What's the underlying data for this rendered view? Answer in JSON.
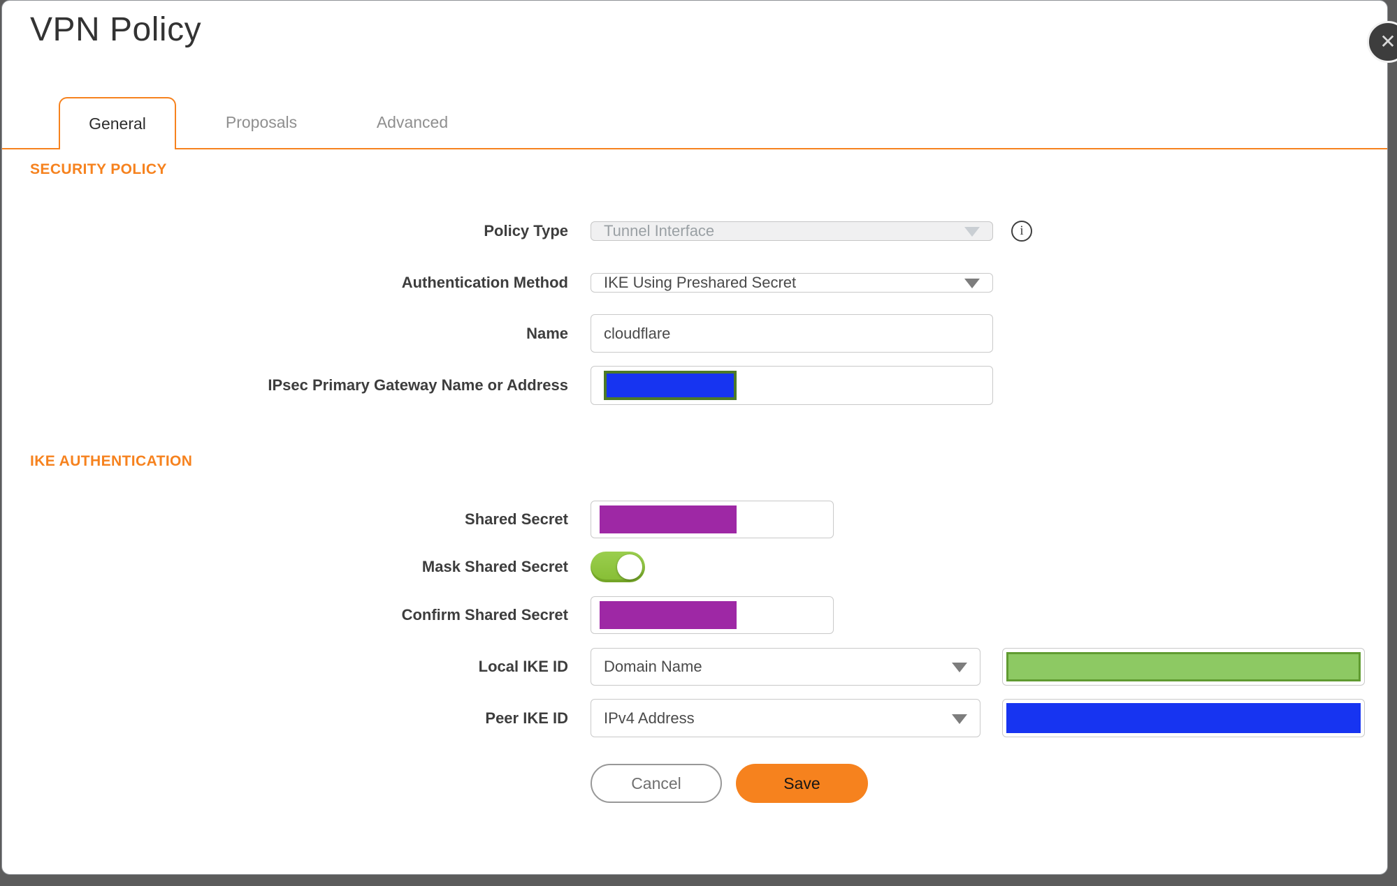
{
  "window": {
    "title": "VPN Policy",
    "close_glyph": "✕"
  },
  "tabs": {
    "general": "General",
    "proposals": "Proposals",
    "advanced": "Advanced",
    "active_tab": "General"
  },
  "security_policy": {
    "heading": "SECURITY POLICY",
    "policy_type_label": "Policy Type",
    "policy_type_value": "Tunnel Interface",
    "policy_type_disabled": true,
    "info_glyph": "i",
    "auth_method_label": "Authentication Method",
    "auth_method_value": "IKE Using Preshared Secret",
    "name_label": "Name",
    "name_value": "cloudflare",
    "gateway_label": "IPsec Primary Gateway Name or Address",
    "gateway_value_redacted": true
  },
  "ike_authentication": {
    "heading": "IKE AUTHENTICATION",
    "shared_secret_label": "Shared Secret",
    "shared_secret_redacted": true,
    "mask_shared_secret_label": "Mask Shared Secret",
    "mask_shared_secret_state": "on",
    "confirm_shared_secret_label": "Confirm Shared Secret",
    "confirm_shared_secret_redacted": true,
    "local_ike_id_label": "Local IKE ID",
    "local_ike_id_type": "Domain Name",
    "local_ike_id_value_redacted": true,
    "peer_ike_id_label": "Peer IKE ID",
    "peer_ike_id_type": "IPv4 Address",
    "peer_ike_id_value_redacted": true
  },
  "actions": {
    "cancel": "Cancel",
    "save": "Save"
  },
  "colors": {
    "accent_orange": "#F6821E",
    "toggle_green": "#8CC63F",
    "redaction_purple": "#9E28A5",
    "redaction_blue": "#1734F1",
    "redaction_green_fill": "#8DC963",
    "redaction_green_border": "#609B31",
    "redaction_olive_border": "#4D7A28",
    "backdrop_gray": "#5C5C5C"
  }
}
